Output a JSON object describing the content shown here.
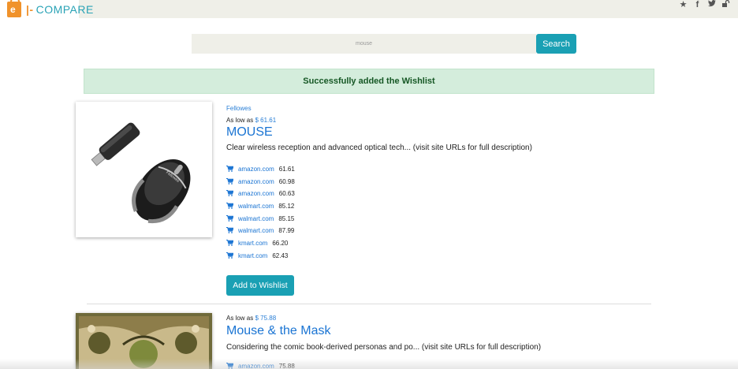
{
  "app": {
    "logo_letter": "e",
    "logo_text": "COMPARE",
    "logo_sep": "|-",
    "brand_color": "#1aa0b4"
  },
  "header_icons": [
    "star-icon",
    "facebook-icon",
    "twitter-icon",
    "unlock-icon"
  ],
  "search": {
    "value": "mouse",
    "button_label": "Search"
  },
  "alert": {
    "message": "Successfully added the Wishlist"
  },
  "products": [
    {
      "brand": "Fellowes",
      "as_low_as_label": "As low as",
      "price": "$ 61.61",
      "title": "MOUSE",
      "description": "Clear wireless reception and advanced optical tech... (visit site URLs for full description)",
      "offers": [
        {
          "store": "amazon.com",
          "price": "61.61"
        },
        {
          "store": "amazon.com",
          "price": "60.98"
        },
        {
          "store": "amazon.com",
          "price": "60.63"
        },
        {
          "store": "walmart.com",
          "price": "85.12"
        },
        {
          "store": "walmart.com",
          "price": "85.15"
        },
        {
          "store": "walmart.com",
          "price": "87.99"
        },
        {
          "store": "kmart.com",
          "price": "66.20"
        },
        {
          "store": "kmart.com",
          "price": "62.43"
        }
      ],
      "wishlist_label": "Add to Wishlist"
    },
    {
      "as_low_as_label": "As low as",
      "price": "$ 75.88",
      "title": "Mouse & the Mask",
      "description": "Considering the comic book-derived personas and po... (visit site URLs for full description)",
      "offers": [
        {
          "store": "amazon.com",
          "price": "75.88"
        }
      ]
    }
  ]
}
